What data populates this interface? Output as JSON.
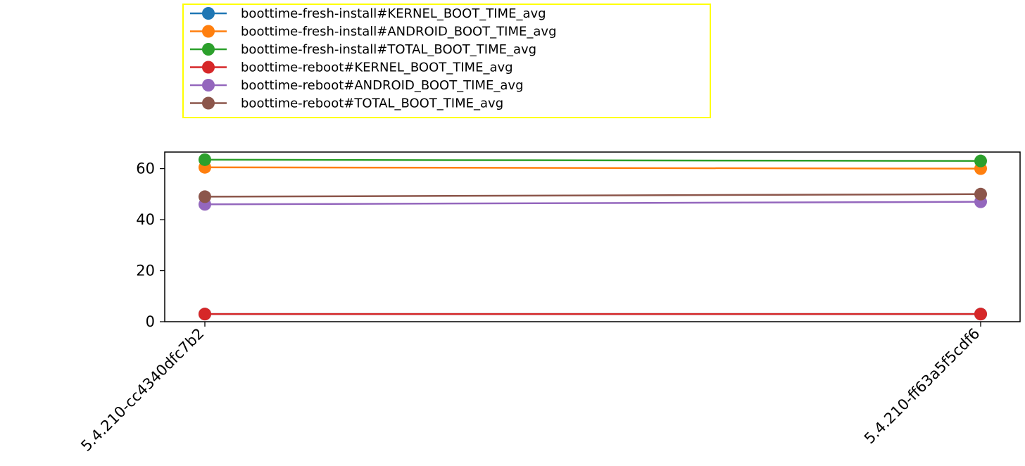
{
  "chart_data": {
    "type": "line",
    "categories": [
      "5.4.210-cc4340dfc7b2",
      "5.4.210-ff63a5f5cdf6"
    ],
    "series": [
      {
        "name": "boottime-fresh-install#KERNEL_BOOT_TIME_avg",
        "color": "#1f77b4",
        "values": [
          3.0,
          3.0
        ]
      },
      {
        "name": "boottime-fresh-install#ANDROID_BOOT_TIME_avg",
        "color": "#ff7f0e",
        "values": [
          60.5,
          60.0
        ]
      },
      {
        "name": "boottime-fresh-install#TOTAL_BOOT_TIME_avg",
        "color": "#2ca02c",
        "values": [
          63.5,
          63.0
        ]
      },
      {
        "name": "boottime-reboot#KERNEL_BOOT_TIME_avg",
        "color": "#d62728",
        "values": [
          3.0,
          3.0
        ]
      },
      {
        "name": "boottime-reboot#ANDROID_BOOT_TIME_avg",
        "color": "#9467bd",
        "values": [
          46.0,
          47.0
        ]
      },
      {
        "name": "boottime-reboot#TOTAL_BOOT_TIME_avg",
        "color": "#8c564b",
        "values": [
          49.0,
          50.0
        ]
      }
    ],
    "yticks": [
      0,
      20,
      40,
      60
    ],
    "ylim": [
      0,
      66.5
    ],
    "grid": false,
    "legend_position": "top-left, above plot",
    "legend_frame_color": "#ffff00",
    "title": "",
    "xlabel": "",
    "ylabel": ""
  }
}
